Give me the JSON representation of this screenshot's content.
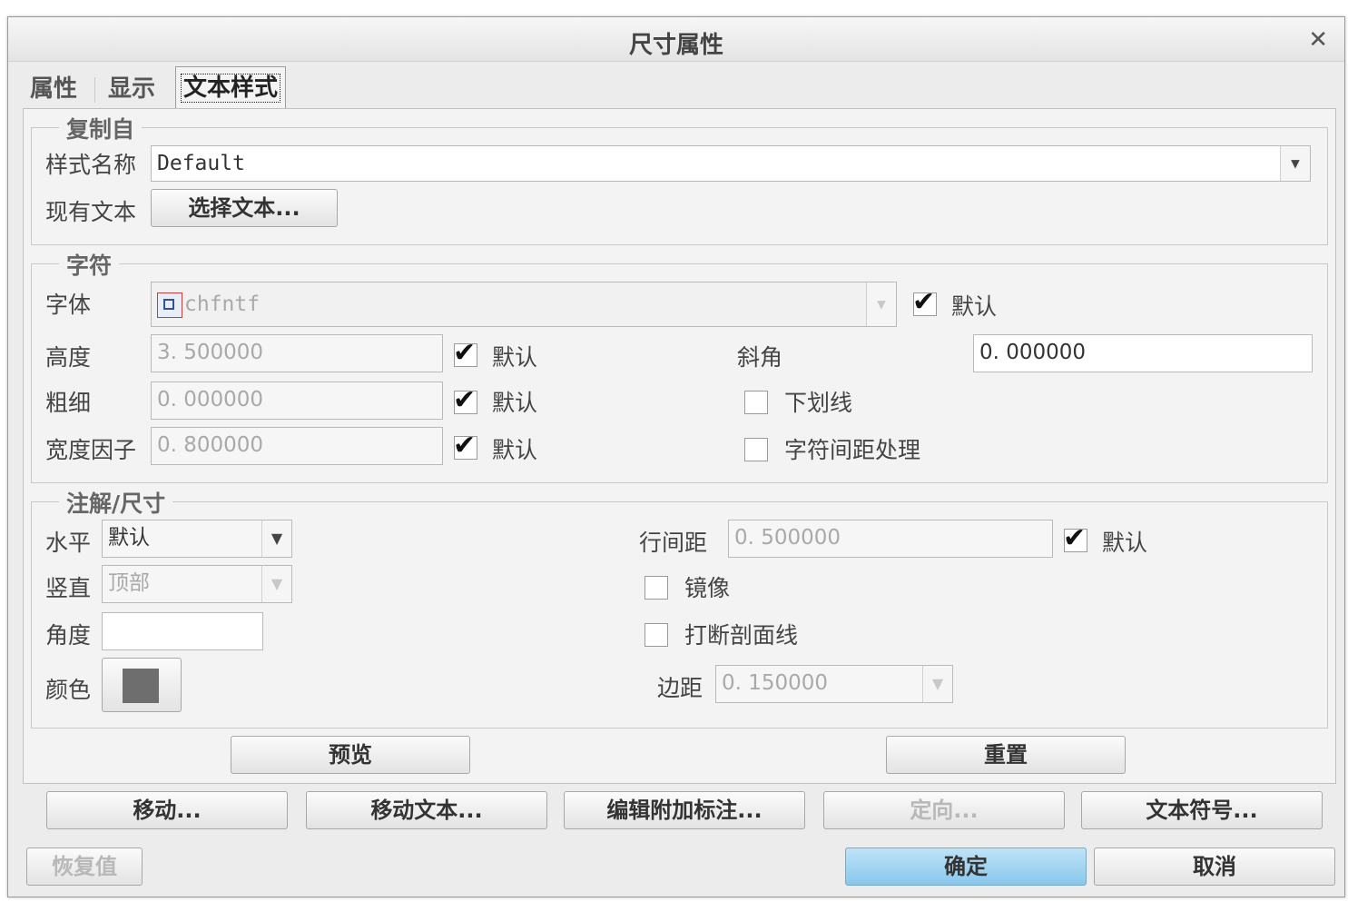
{
  "window": {
    "title": "尺寸属性"
  },
  "tabs": [
    {
      "label": "属性"
    },
    {
      "label": "显示"
    },
    {
      "label": "文本样式",
      "active": true
    }
  ],
  "copy_from": {
    "title": "复制自",
    "style_name_label": "样式名称",
    "style_name_value": "Default",
    "existing_text_label": "现有文本",
    "select_text_button": "选择文本..."
  },
  "character": {
    "title": "字符",
    "font_label": "字体",
    "font_value": "chfntf",
    "font_default": {
      "label": "默认",
      "checked": true
    },
    "height_label": "高度",
    "height_value": "3. 500000",
    "height_default": {
      "label": "默认",
      "checked": true
    },
    "thickness_label": "粗细",
    "thickness_value": "0. 000000",
    "thickness_default": {
      "label": "默认",
      "checked": true
    },
    "width_factor_label": "宽度因子",
    "width_factor_value": "0. 800000",
    "width_factor_default": {
      "label": "默认",
      "checked": true
    },
    "slant_label": "斜角",
    "slant_value": "0. 000000",
    "underline": {
      "label": "下划线",
      "checked": false
    },
    "kerning": {
      "label": "字符间距处理",
      "checked": false
    }
  },
  "note_dim": {
    "title": "注解/尺寸",
    "horizontal_label": "水平",
    "horizontal_value": "默认",
    "vertical_label": "竖直",
    "vertical_value": "顶部",
    "angle_label": "角度",
    "angle_value": "",
    "color_label": "颜色",
    "color_swatch": "#6e6e6e",
    "line_spacing_label": "行间距",
    "line_spacing_value": "0. 500000",
    "line_spacing_default": {
      "label": "默认",
      "checked": true
    },
    "mirror": {
      "label": "镜像",
      "checked": false
    },
    "break_hatch": {
      "label": "打断剖面线",
      "checked": false
    },
    "margin_label": "边距",
    "margin_value": "0. 150000"
  },
  "panel_buttons": {
    "preview": "预览",
    "reset": "重置"
  },
  "action_buttons": {
    "move": "移动...",
    "move_text": "移动文本...",
    "edit_attached_note": "编辑附加标注...",
    "orient": "定向...",
    "text_symbol": "文本符号..."
  },
  "footer": {
    "restore": "恢复值",
    "ok": "确定",
    "cancel": "取消"
  }
}
